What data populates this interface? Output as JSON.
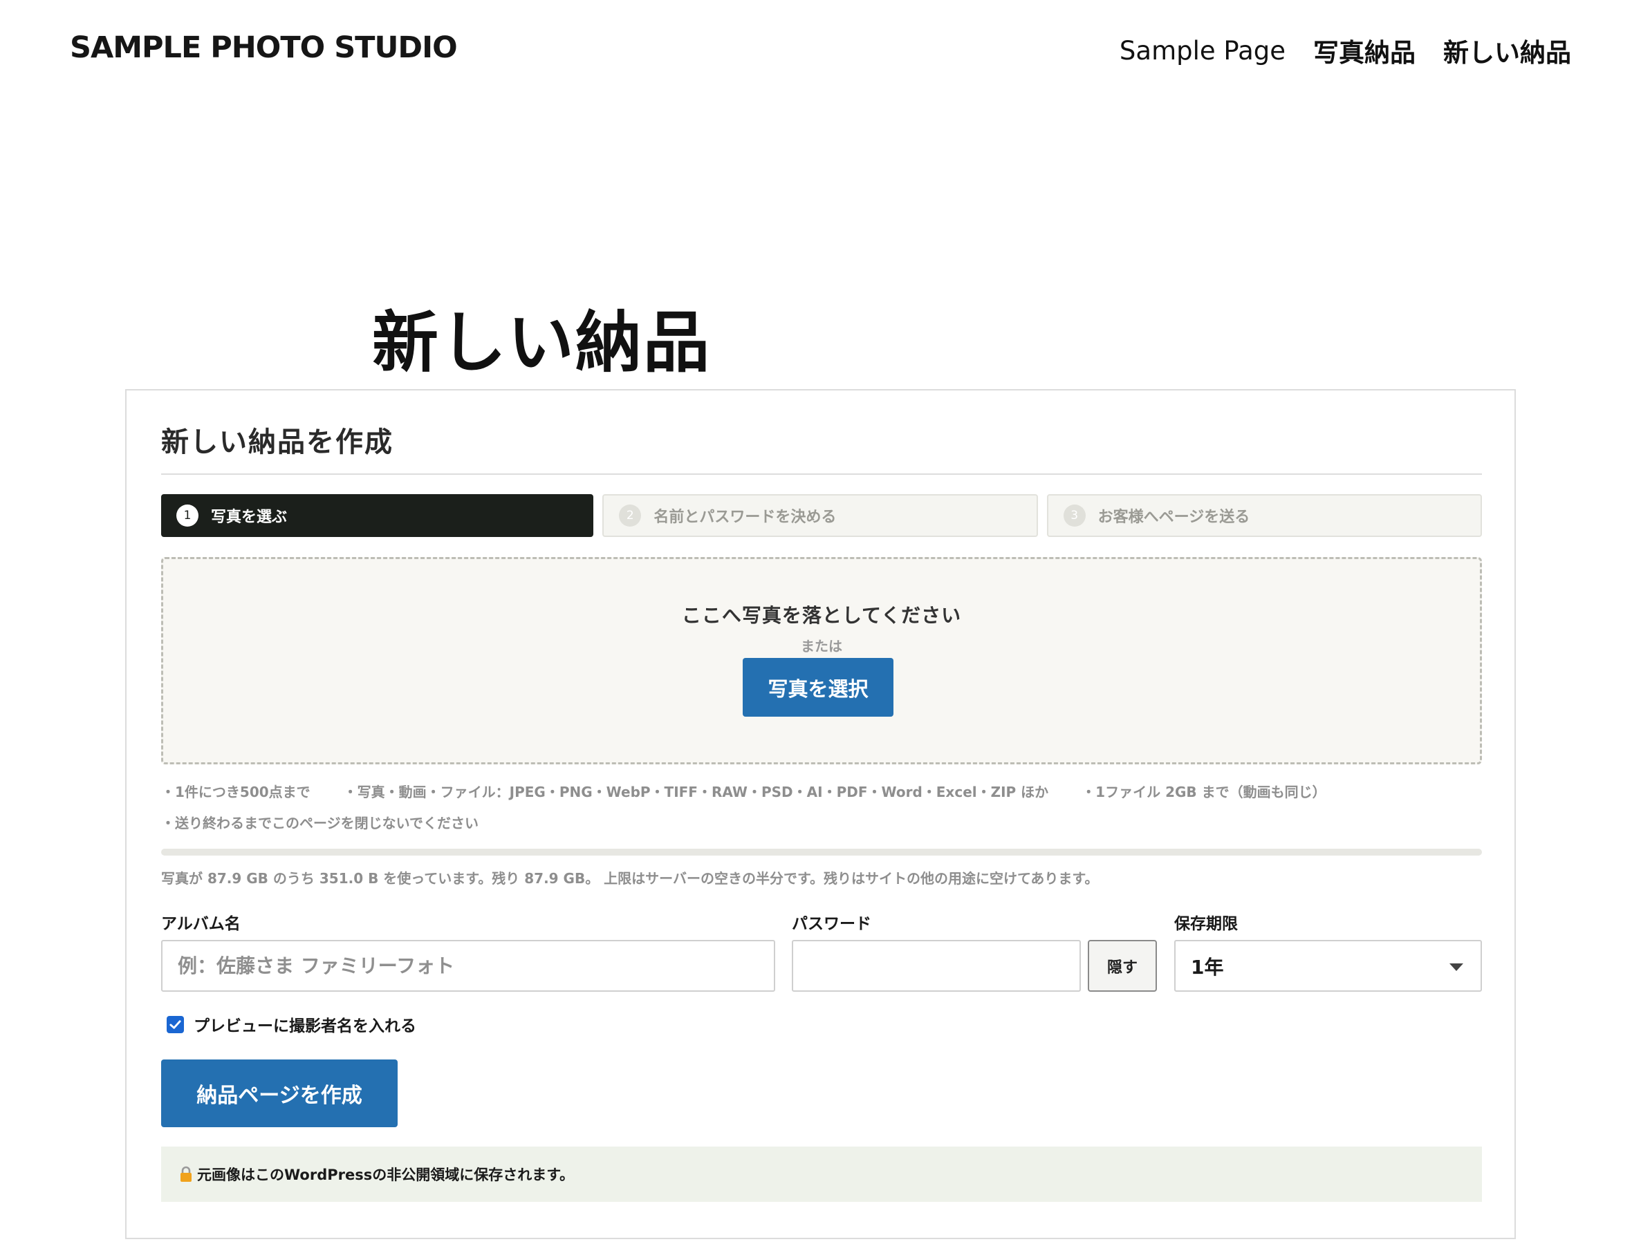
{
  "header": {
    "site_title": "SAMPLE PHOTO STUDIO",
    "nav": [
      "Sample Page",
      "写真納品",
      "新しい納品"
    ]
  },
  "page": {
    "title": "新しい納品"
  },
  "form": {
    "heading": "新しい納品を作成",
    "steps": [
      {
        "number": "1",
        "label": "写真を選ぶ",
        "state": "active"
      },
      {
        "number": "2",
        "label": "名前とパスワードを決める",
        "state": "inactive"
      },
      {
        "number": "3",
        "label": "お客様へページを送る",
        "state": "inactive"
      }
    ],
    "dropzone": {
      "message": "ここへ写真を落としてください",
      "or_text": "または",
      "button_label": "写真を選択"
    },
    "notes": {
      "row1": [
        "・1件につき500点まで",
        "・写真・動画・ファイル：JPEG・PNG・WebP・TIFF・RAW・PSD・AI・PDF・Word・Excel・ZIP ほか",
        "・1ファイル 2GB まで（動画も同じ）"
      ],
      "row2": "・送り終わるまでこのページを閉じないでください"
    },
    "usage": {
      "fraction_used": 0.0,
      "text": "写真が 87.9 GB のうち 351.0 B を使っています。残り 87.9 GB。 上限はサーバーの空きの半分です。残りはサイトの他の用途に空けてあります。"
    },
    "album": {
      "label": "アルバム名",
      "placeholder": "例：佐藤さま ファミリーフォト",
      "value": ""
    },
    "password": {
      "label": "パスワード",
      "value": "",
      "hide_label": "隠す"
    },
    "retention": {
      "label": "保存期限",
      "selected": "1年"
    },
    "watermark_checkbox": {
      "checked": true,
      "label": "プレビューに撮影者名を入れる"
    },
    "submit_label": "納品ページを作成",
    "notice": "元画像はこのWordPressの非公開領域に保存されます。"
  },
  "colors": {
    "accent": "#2470b1",
    "active_step": "#1b1f1b",
    "dropzone_bg": "#f8f7f3",
    "notice_bg": "#eef2ea",
    "lock": "#f0a21c"
  }
}
